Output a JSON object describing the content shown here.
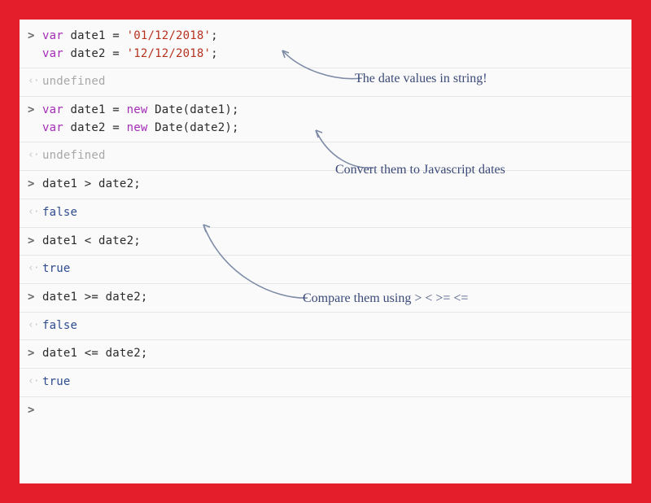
{
  "console": {
    "rows": [
      {
        "kind": "in",
        "parts": [
          {
            "t": "kw",
            "v": "var"
          },
          {
            "t": "p",
            "v": " date1 "
          },
          {
            "t": "op",
            "v": "="
          },
          {
            "t": "p",
            "v": " "
          },
          {
            "t": "str",
            "v": "'01/12/2018'"
          },
          {
            "t": "p",
            "v": ";\n"
          },
          {
            "t": "kw",
            "v": "var"
          },
          {
            "t": "p",
            "v": " date2 "
          },
          {
            "t": "op",
            "v": "="
          },
          {
            "t": "p",
            "v": " "
          },
          {
            "t": "str",
            "v": "'12/12/2018'"
          },
          {
            "t": "p",
            "v": ";"
          }
        ]
      },
      {
        "kind": "out",
        "parts": [
          {
            "t": "undef",
            "v": "undefined"
          }
        ]
      },
      {
        "kind": "in",
        "parts": [
          {
            "t": "kw",
            "v": "var"
          },
          {
            "t": "p",
            "v": " date1 "
          },
          {
            "t": "op",
            "v": "="
          },
          {
            "t": "p",
            "v": " "
          },
          {
            "t": "nw",
            "v": "new"
          },
          {
            "t": "p",
            "v": " Date(date1);\n"
          },
          {
            "t": "kw",
            "v": "var"
          },
          {
            "t": "p",
            "v": " date2 "
          },
          {
            "t": "op",
            "v": "="
          },
          {
            "t": "p",
            "v": " "
          },
          {
            "t": "nw",
            "v": "new"
          },
          {
            "t": "p",
            "v": " Date(date2);"
          }
        ]
      },
      {
        "kind": "out",
        "parts": [
          {
            "t": "undef",
            "v": "undefined"
          }
        ]
      },
      {
        "kind": "in",
        "parts": [
          {
            "t": "p",
            "v": "date1 "
          },
          {
            "t": "op",
            "v": ">"
          },
          {
            "t": "p",
            "v": " date2;"
          }
        ]
      },
      {
        "kind": "out",
        "parts": [
          {
            "t": "bool",
            "v": "false"
          }
        ]
      },
      {
        "kind": "in",
        "parts": [
          {
            "t": "p",
            "v": "date1 "
          },
          {
            "t": "op",
            "v": "<"
          },
          {
            "t": "p",
            "v": " date2;"
          }
        ]
      },
      {
        "kind": "out",
        "parts": [
          {
            "t": "bool",
            "v": "true"
          }
        ]
      },
      {
        "kind": "in",
        "parts": [
          {
            "t": "p",
            "v": "date1 "
          },
          {
            "t": "op",
            "v": ">="
          },
          {
            "t": "p",
            "v": " date2;"
          }
        ]
      },
      {
        "kind": "out",
        "parts": [
          {
            "t": "bool",
            "v": "false"
          }
        ]
      },
      {
        "kind": "in",
        "parts": [
          {
            "t": "p",
            "v": "date1 "
          },
          {
            "t": "op",
            "v": "<="
          },
          {
            "t": "p",
            "v": " date2;"
          }
        ]
      },
      {
        "kind": "out",
        "parts": [
          {
            "t": "bool",
            "v": "true"
          }
        ]
      },
      {
        "kind": "in",
        "parts": []
      }
    ]
  },
  "annotations": {
    "a1": "The date values in string!",
    "a2": "Convert them to Javascript dates",
    "a3": "Compare them using > < >= <="
  }
}
